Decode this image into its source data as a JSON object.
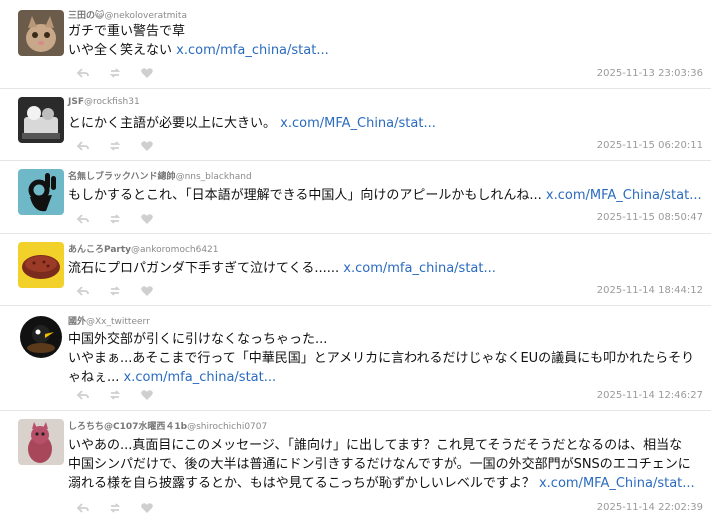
{
  "posts": [
    {
      "display_name": "三田の😺",
      "handle": "@nekoloveratmita",
      "lines": [
        "ガチで重い警告で草",
        "いや全く笑えない "
      ],
      "link": "x.com/mfa_china/stat...",
      "timestamp": "2025-11-13 23:03:36",
      "avatar": "cat-photo-avatar"
    },
    {
      "display_name": "JSF",
      "handle": "@rockfish31",
      "lines": [
        "とにかく主語が必要以上に大きい。 "
      ],
      "link": "x.com/MFA_China/stat...",
      "timestamp": "2025-11-15 06:20:11",
      "avatar": "figure-photo-avatar"
    },
    {
      "display_name": "名無しブラックハンド總帥",
      "handle": "@nns_blackhand",
      "lines": [
        "もしかするとこれ、「日本語が理解できる中国人」向けのアピールかもしれんね... "
      ],
      "link": "x.com/MFA_China/stat...",
      "timestamp": "2025-11-15 08:50:47",
      "avatar": "ok-hand-avatar"
    },
    {
      "display_name": "あんころParty",
      "handle": "@ankoromoch6421",
      "lines": [
        "流石にプロパガンダ下手すぎて泣けてくる...... "
      ],
      "link": "x.com/mfa_china/stat...",
      "timestamp": "2025-11-14 18:44:12",
      "avatar": "ohagi-avatar"
    },
    {
      "display_name": "國外",
      "handle": "@Xx_twitteerr",
      "lines": [
        "中国外交部が引くに引けなくなっちゃった...",
        "いやまぁ...あそこまで行って「中華民国」とアメリカに言われるだけじゃなくEUの議員にも叩かれたらそり",
        "ゃねぇ... "
      ],
      "link": "x.com/mfa_china/stat...",
      "timestamp": "2025-11-14 12:46:27",
      "avatar": "bird-icon-avatar"
    },
    {
      "display_name": "しろちち@C107水曜西４1b",
      "handle": "@shirochichi0707",
      "lines": [
        "いやあの...真面目にこのメッセージ、「誰向け」に出してます？これ見てそうだそうだとなるのは、相当な",
        "中国シンパだけで、後の大半は普通にドン引きするだけなんですが。一国の外交部門がSNSのエコチェンに",
        "溺れる様を自ら披露するとか、もはや見てるこっちが恥ずかしいレベルですよ？ "
      ],
      "link": "x.com/MFA_China/stat...",
      "timestamp": "2025-11-14 22:02:39",
      "avatar": "plush-photo-avatar"
    }
  ]
}
